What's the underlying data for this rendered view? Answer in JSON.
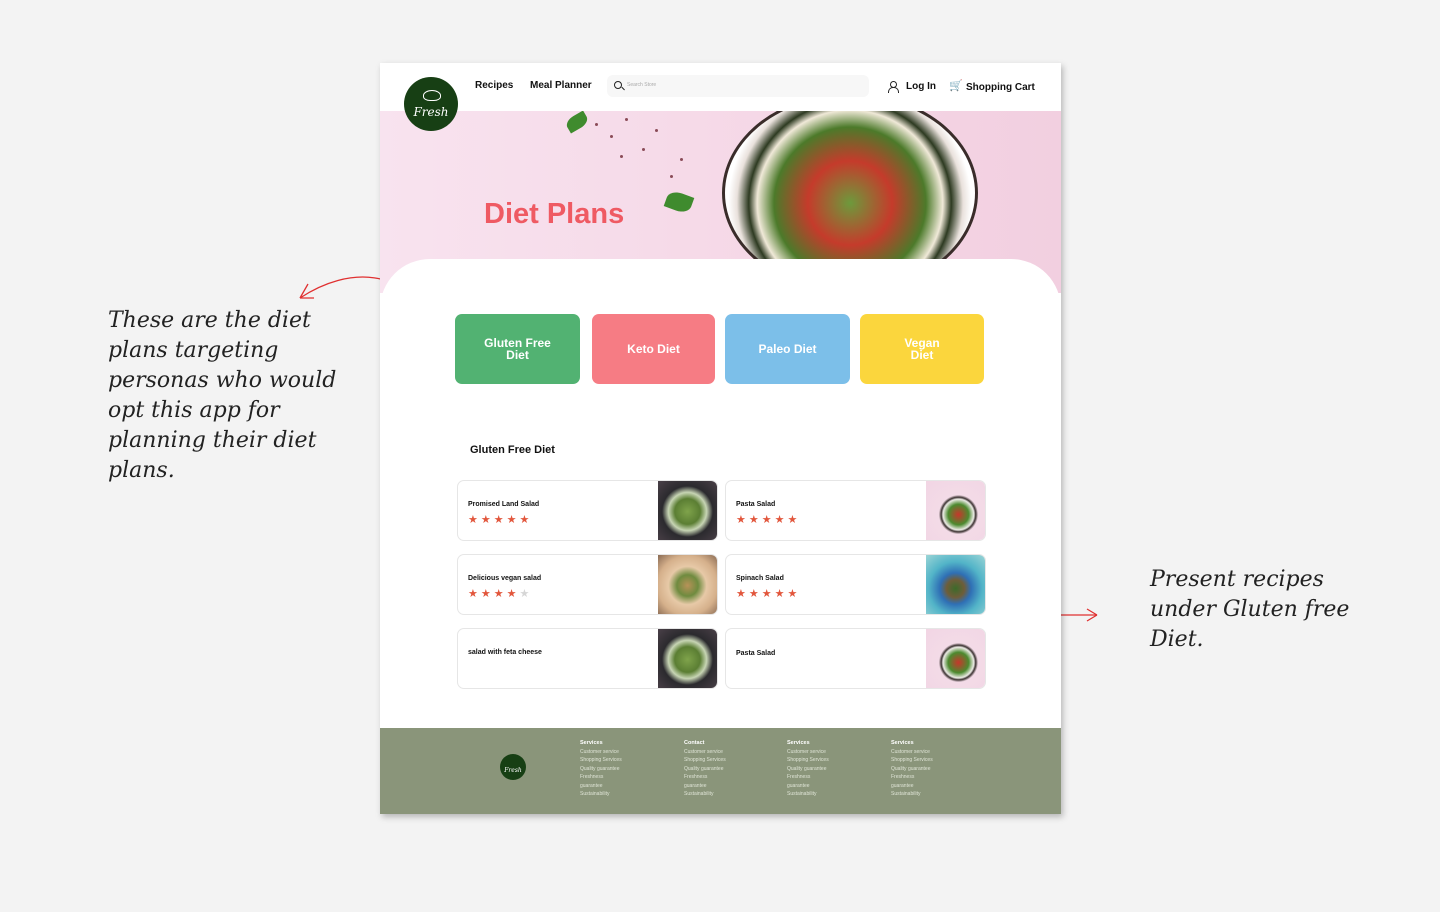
{
  "annotations": {
    "left_note": "These are the diet plans targeting personas who would opt this app for planning their diet plans.",
    "right_note": "Present recipes under Gluten free Diet."
  },
  "nav": {
    "logo": "Fresh",
    "links": [
      "Recipes",
      "Meal Planner"
    ],
    "search_placeholder": "Search Store",
    "login": "Log In",
    "cart": "Shopping Cart"
  },
  "hero": {
    "title": "Diet Plans"
  },
  "diet_buttons": [
    {
      "label": "Gluten Free Diet",
      "color": "#52b272"
    },
    {
      "label": "Keto Diet",
      "color": "#f67c84"
    },
    {
      "label": "Paleo Diet",
      "color": "#7cbfe9"
    },
    {
      "label": "Vegan Diet",
      "color": "#fbd63d"
    }
  ],
  "section_title": "Gluten Free Diet",
  "recipes": [
    {
      "name": "Promised Land Salad",
      "rating": 5
    },
    {
      "name": "Pasta Salad",
      "rating": 5
    },
    {
      "name": "Delicious vegan salad",
      "rating": 4
    },
    {
      "name": "Spinach Salad",
      "rating": 5
    },
    {
      "name": "salad with feta cheese",
      "rating": null
    },
    {
      "name": "Pasta Salad",
      "rating": null
    }
  ],
  "footer": {
    "logo": "Fresh",
    "columns": [
      {
        "title": "Services",
        "items": [
          "Customer service",
          "Shopping Services",
          "Quality guarantee",
          "Freshness",
          "guarantee",
          "Sustainability"
        ]
      },
      {
        "title": "Contact",
        "items": [
          "Customer service",
          "Shopping Services",
          "Quality guarantee",
          "Freshness",
          "guarantee",
          "Sustainability"
        ]
      },
      {
        "title": "Services",
        "items": [
          "Customer service",
          "Shopping Services",
          "Quality guarantee",
          "Freshness",
          "guarantee",
          "Sustainability"
        ]
      },
      {
        "title": "Services",
        "items": [
          "Customer service",
          "Shopping Services",
          "Quality guarantee",
          "Freshness",
          "guarantee",
          "Sustainability"
        ]
      }
    ]
  },
  "colors": {
    "accent_red": "#ef5a63",
    "star": "#e2563c",
    "logo_green": "#173f14",
    "footer": "#8a957a",
    "arrow": "#e03030"
  }
}
